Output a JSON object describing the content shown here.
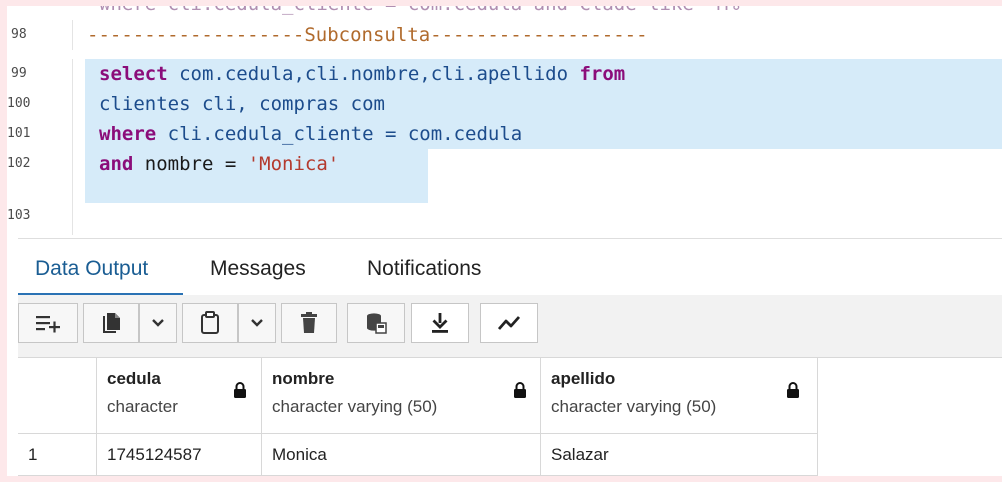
{
  "editor": {
    "cutoff_text": "where cli.cedula_cliente = com.cedula and Clade like 'M%'",
    "line_numbers": [
      "98",
      "99",
      "100",
      "101",
      "102",
      "103"
    ],
    "comment_line": "-------------------Subconsulta-------------------",
    "line99": {
      "kw_select": "select",
      "cols": " com.cedula,cli.nombre,cli.apellido ",
      "kw_from": "from"
    },
    "line100": {
      "text": "clientes cli, compras com"
    },
    "line101": {
      "kw_where": "where",
      "cond": " cli.cedula_cliente = com.cedula"
    },
    "line102": {
      "kw_and": "and",
      "cond": " nombre = ",
      "value": "'Monica'"
    }
  },
  "tabs": {
    "items": [
      {
        "label": "Data Output"
      },
      {
        "label": "Messages"
      },
      {
        "label": "Notifications"
      }
    ],
    "active": "Data Output"
  },
  "toolbar": {
    "icons": [
      "add-row-icon",
      "copy-icon",
      "chevron-down-icon",
      "paste-icon",
      "chevron-down-icon",
      "delete-icon",
      "save-data-icon",
      "download-icon",
      "graph-visualiser-icon"
    ]
  },
  "grid": {
    "columns": [
      {
        "name": "cedula",
        "type": "character"
      },
      {
        "name": "nombre",
        "type": "character varying (50)"
      },
      {
        "name": "apellido",
        "type": "character varying (50)"
      }
    ],
    "rows": [
      {
        "num": "1",
        "cells": [
          "1745124587",
          "Monica",
          "Salazar"
        ]
      }
    ]
  },
  "colors": {
    "keyword": "#8b0d7a",
    "identifier": "#1c4c8c",
    "string": "#b43a2e",
    "comment": "#b06a2c",
    "selection": "#d6ebf9",
    "tab_active": "#2a72b4"
  }
}
